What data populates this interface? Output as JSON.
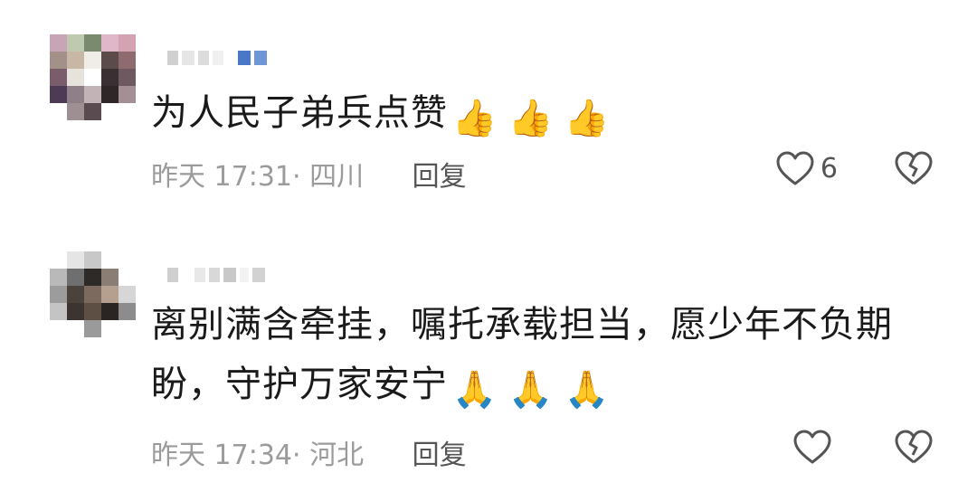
{
  "comments": [
    {
      "text": "为人民子弟兵点赞",
      "emojis": [
        "👍",
        "👍",
        "👍"
      ],
      "time": "昨天 17:31",
      "location": "四川",
      "reply_label": "回复",
      "like_count": "6",
      "icons": {
        "like": "heart-icon",
        "dislike": "broken-heart-icon"
      },
      "avatar_colors": [
        "#c7a4b6",
        "#bfc9b0",
        "#7a8a6f",
        "#e0b7c8",
        "#d4a2b0",
        "#a39088",
        "#c9b7a6",
        "#f0ede8",
        "#5c4b4b",
        "#8d6b6e",
        "#7a5c6a",
        "#e8e2dc",
        "#ffffff",
        "#3a2f33",
        "#6e5960",
        "#4d3a55",
        "#8f7f86",
        "#c2b3b6",
        "#2f2628",
        "#a38f94",
        "#ffffff",
        "#9e8f92",
        "#5a4b50",
        "#ffffff",
        "#ffffff"
      ]
    },
    {
      "text": "离别满含牵挂，嘱托承载担当，愿少年不负期盼，守护万家安宁",
      "emojis": [
        "🙏",
        "🙏",
        "🙏"
      ],
      "time": "昨天 17:34",
      "location": "河北",
      "reply_label": "回复",
      "like_count": "",
      "icons": {
        "like": "heart-icon",
        "dislike": "broken-heart-icon"
      },
      "avatar_colors": [
        "#ffffff",
        "#e5e5e5",
        "#c8c8c8",
        "#ffffff",
        "#ffffff",
        "#b9b9b9",
        "#6f6f6f",
        "#2e2a27",
        "#8a7d74",
        "#ffffff",
        "#9c9c9c",
        "#4a423d",
        "#7d6a5e",
        "#b59f8f",
        "#d6d6d6",
        "#c4c4c4",
        "#3b3430",
        "#5e4f45",
        "#2a2522",
        "#8c8c8c",
        "#ffffff",
        "#ffffff",
        "#9a9a9a",
        "#ffffff",
        "#ffffff"
      ]
    }
  ],
  "colors": {
    "text": "#1a1a1a",
    "meta": "#9b9b9b",
    "action": "#555555"
  }
}
